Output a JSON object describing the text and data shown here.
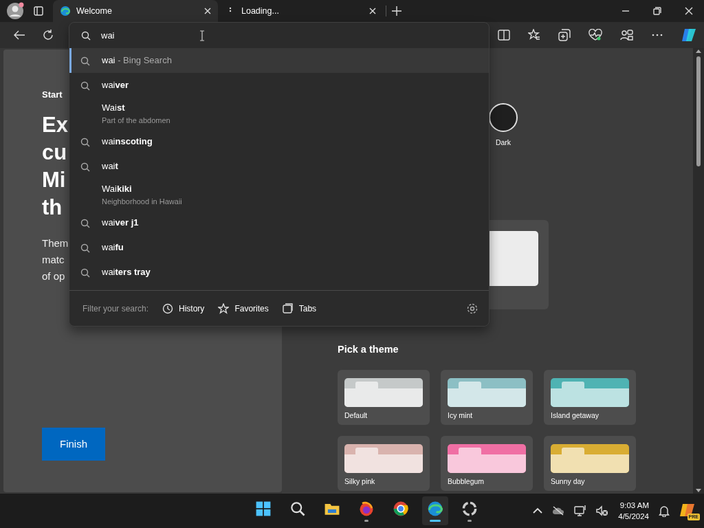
{
  "tabs": [
    {
      "title": "Welcome",
      "selected": true,
      "kind": "page"
    },
    {
      "title": "Loading...",
      "selected": false,
      "kind": "loading"
    }
  ],
  "address_bar": {
    "value": "wai"
  },
  "suggestions": [
    {
      "kind": "search",
      "text": "wai",
      "suffix": "- Bing Search",
      "selected": true
    },
    {
      "kind": "search",
      "text": "wai**ver**",
      "selected": false
    },
    {
      "kind": "entity",
      "text": "Wai**st**",
      "subtitle": "Part of the abdomen",
      "selected": false
    },
    {
      "kind": "search",
      "text": "wai**nscoting**",
      "selected": false
    },
    {
      "kind": "search",
      "text": "wai**t**",
      "selected": false
    },
    {
      "kind": "entity",
      "text": "Wai**kiki**",
      "subtitle": "Neighborhood in Hawaii",
      "selected": false
    },
    {
      "kind": "search",
      "text": "wai**ver j1**",
      "selected": false
    },
    {
      "kind": "search",
      "text": "wai**fu**",
      "selected": false
    },
    {
      "kind": "search",
      "text": "wai**ters tray**",
      "selected": false
    }
  ],
  "filter": {
    "label": "Filter your search:",
    "options": [
      {
        "kind": "history",
        "label": "History"
      },
      {
        "kind": "favorites",
        "label": "Favorites"
      },
      {
        "kind": "tabs",
        "label": "Tabs"
      }
    ]
  },
  "welcome": {
    "eyebrow": "Start",
    "heading_lines": [
      "Ex",
      "cu",
      "Mi",
      "th"
    ],
    "body_lines": [
      "Them",
      "matc",
      "of op"
    ],
    "button": "Finish"
  },
  "appearance": {
    "mode_label": "Dark",
    "section_title": "Pick a theme",
    "themes": [
      {
        "name": "Default",
        "color": "#c5c9c9"
      },
      {
        "name": "Icy mint",
        "color": "#8cbfc4"
      },
      {
        "name": "Island getaway",
        "color": "#4fb3b3"
      },
      {
        "name": "Silky pink",
        "color": "#d9b3ae"
      },
      {
        "name": "Bubblegum",
        "color": "#f06fa4"
      },
      {
        "name": "Sunny day",
        "color": "#d9ad33"
      }
    ]
  },
  "taskbar": {
    "apps": [
      {
        "kind": "start",
        "open": false,
        "selected": false
      },
      {
        "kind": "search",
        "open": false,
        "selected": false
      },
      {
        "kind": "files",
        "open": false,
        "selected": false
      },
      {
        "kind": "firefox",
        "open": true,
        "selected": false
      },
      {
        "kind": "chrome",
        "open": false,
        "selected": false
      },
      {
        "kind": "edge",
        "open": true,
        "selected": true
      },
      {
        "kind": "circle",
        "open": true,
        "selected": false
      }
    ],
    "time": "9:03 AM",
    "date": "4/5/2024",
    "badge": "PRE"
  }
}
